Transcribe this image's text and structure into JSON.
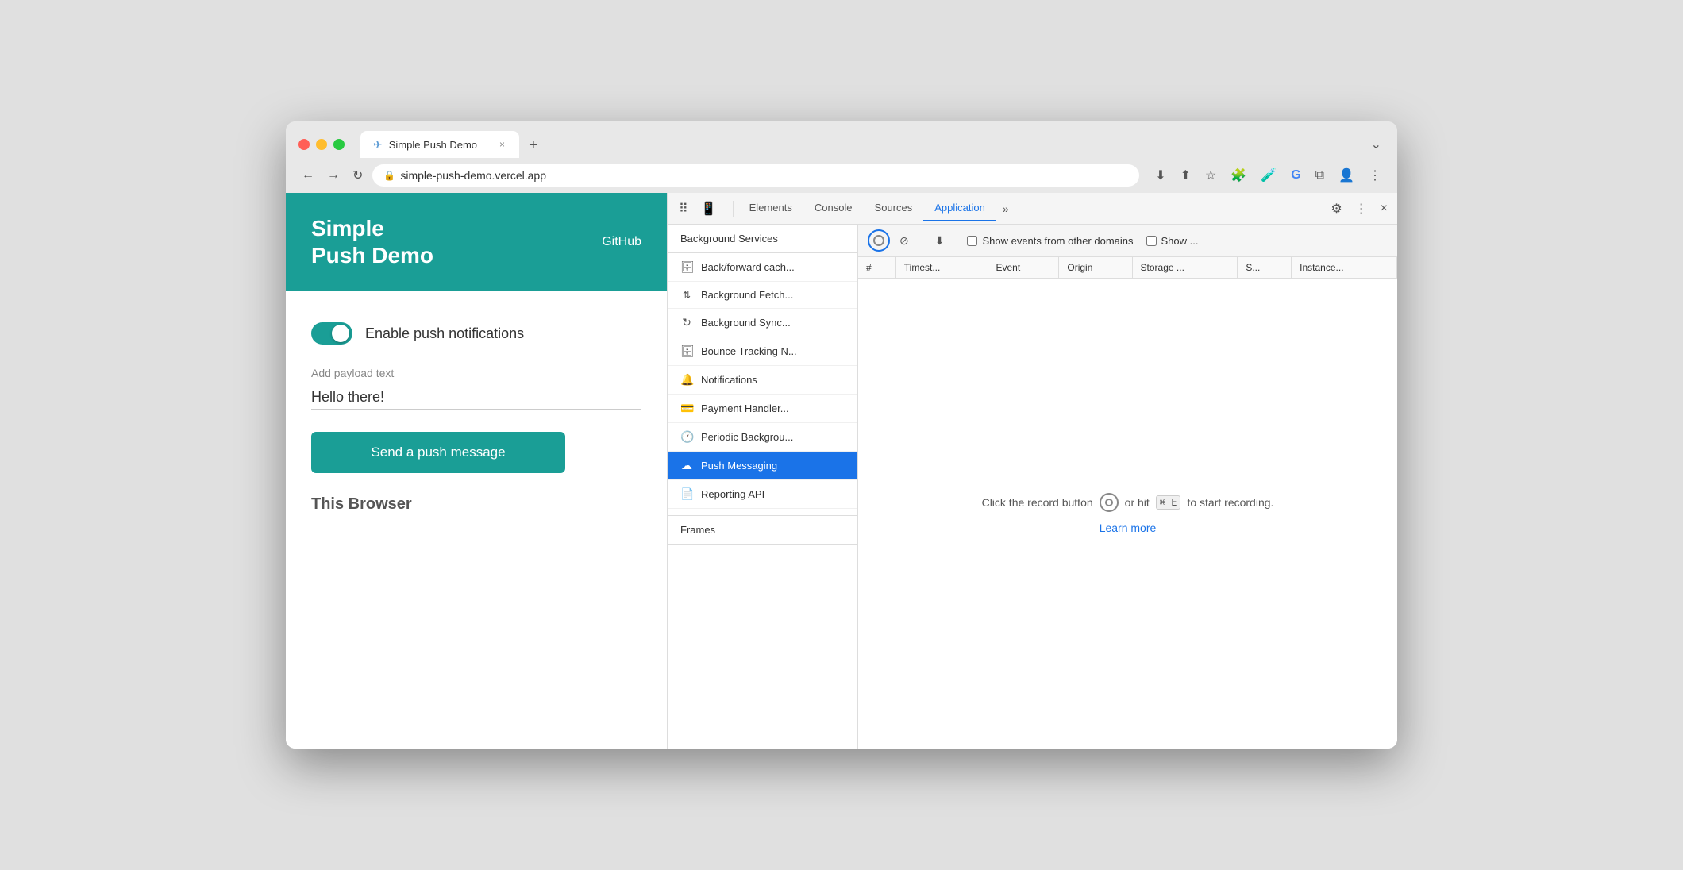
{
  "browser": {
    "tab_title": "Simple Push Demo",
    "tab_icon": "✈",
    "url": "simple-push-demo.vercel.app",
    "close_symbol": "×",
    "new_tab_symbol": "+",
    "more_symbol": "⌄"
  },
  "nav": {
    "back": "←",
    "forward": "→",
    "reload": "↻"
  },
  "toolbar": {
    "download": "⬇",
    "share": "⬆",
    "star": "☆",
    "extension": "🧩",
    "lab": "🧪",
    "google": "G",
    "sidebar": "⧉",
    "profile": "👤",
    "more": "⋮"
  },
  "webpage": {
    "header_title_line1": "Simple",
    "header_title_line2": "Push Demo",
    "github_label": "GitHub",
    "toggle_label": "Enable push notifications",
    "payload_label": "Add payload text",
    "payload_value": "Hello there!",
    "send_button_label": "Send a push message",
    "this_browser_label": "This Browser"
  },
  "devtools": {
    "tabs": [
      {
        "id": "elements",
        "label": "Elements"
      },
      {
        "id": "console",
        "label": "Console"
      },
      {
        "id": "sources",
        "label": "Sources"
      },
      {
        "id": "application",
        "label": "Application",
        "active": true
      }
    ],
    "more_tabs": ">>",
    "settings_icon": "⚙",
    "more_icon": "⋮",
    "close_icon": "×",
    "toolbar": {
      "record_title": "Record",
      "clear_title": "Clear",
      "download_title": "Export",
      "show_other_domains_label": "Show events from other domains",
      "show_label": "Show ..."
    },
    "table_headers": [
      "#",
      "Timest...",
      "Event",
      "Origin",
      "Storage ...",
      "S...",
      "Instance..."
    ],
    "empty_state": {
      "text_before": "Click the record button",
      "text_after": "or hit",
      "kbd": "⌘ E",
      "text_end": "to start recording."
    },
    "learn_more_label": "Learn more"
  },
  "background_services": {
    "header": "Background Services",
    "items": [
      {
        "id": "back-forward",
        "icon": "🗄",
        "label": "Back/forward cach..."
      },
      {
        "id": "background-fetch",
        "icon": "↑↓",
        "label": "Background Fetch..."
      },
      {
        "id": "background-sync",
        "icon": "↻",
        "label": "Background Sync..."
      },
      {
        "id": "bounce-tracking",
        "icon": "🗄",
        "label": "Bounce Tracking N..."
      },
      {
        "id": "notifications",
        "icon": "🔔",
        "label": "Notifications"
      },
      {
        "id": "payment-handler",
        "icon": "💳",
        "label": "Payment Handler..."
      },
      {
        "id": "periodic-background",
        "icon": "🕐",
        "label": "Periodic Backgrou..."
      },
      {
        "id": "push-messaging",
        "icon": "☁",
        "label": "Push Messaging",
        "active": true
      },
      {
        "id": "reporting-api",
        "icon": "📄",
        "label": "Reporting API"
      }
    ]
  },
  "frames": {
    "label": "Frames"
  }
}
